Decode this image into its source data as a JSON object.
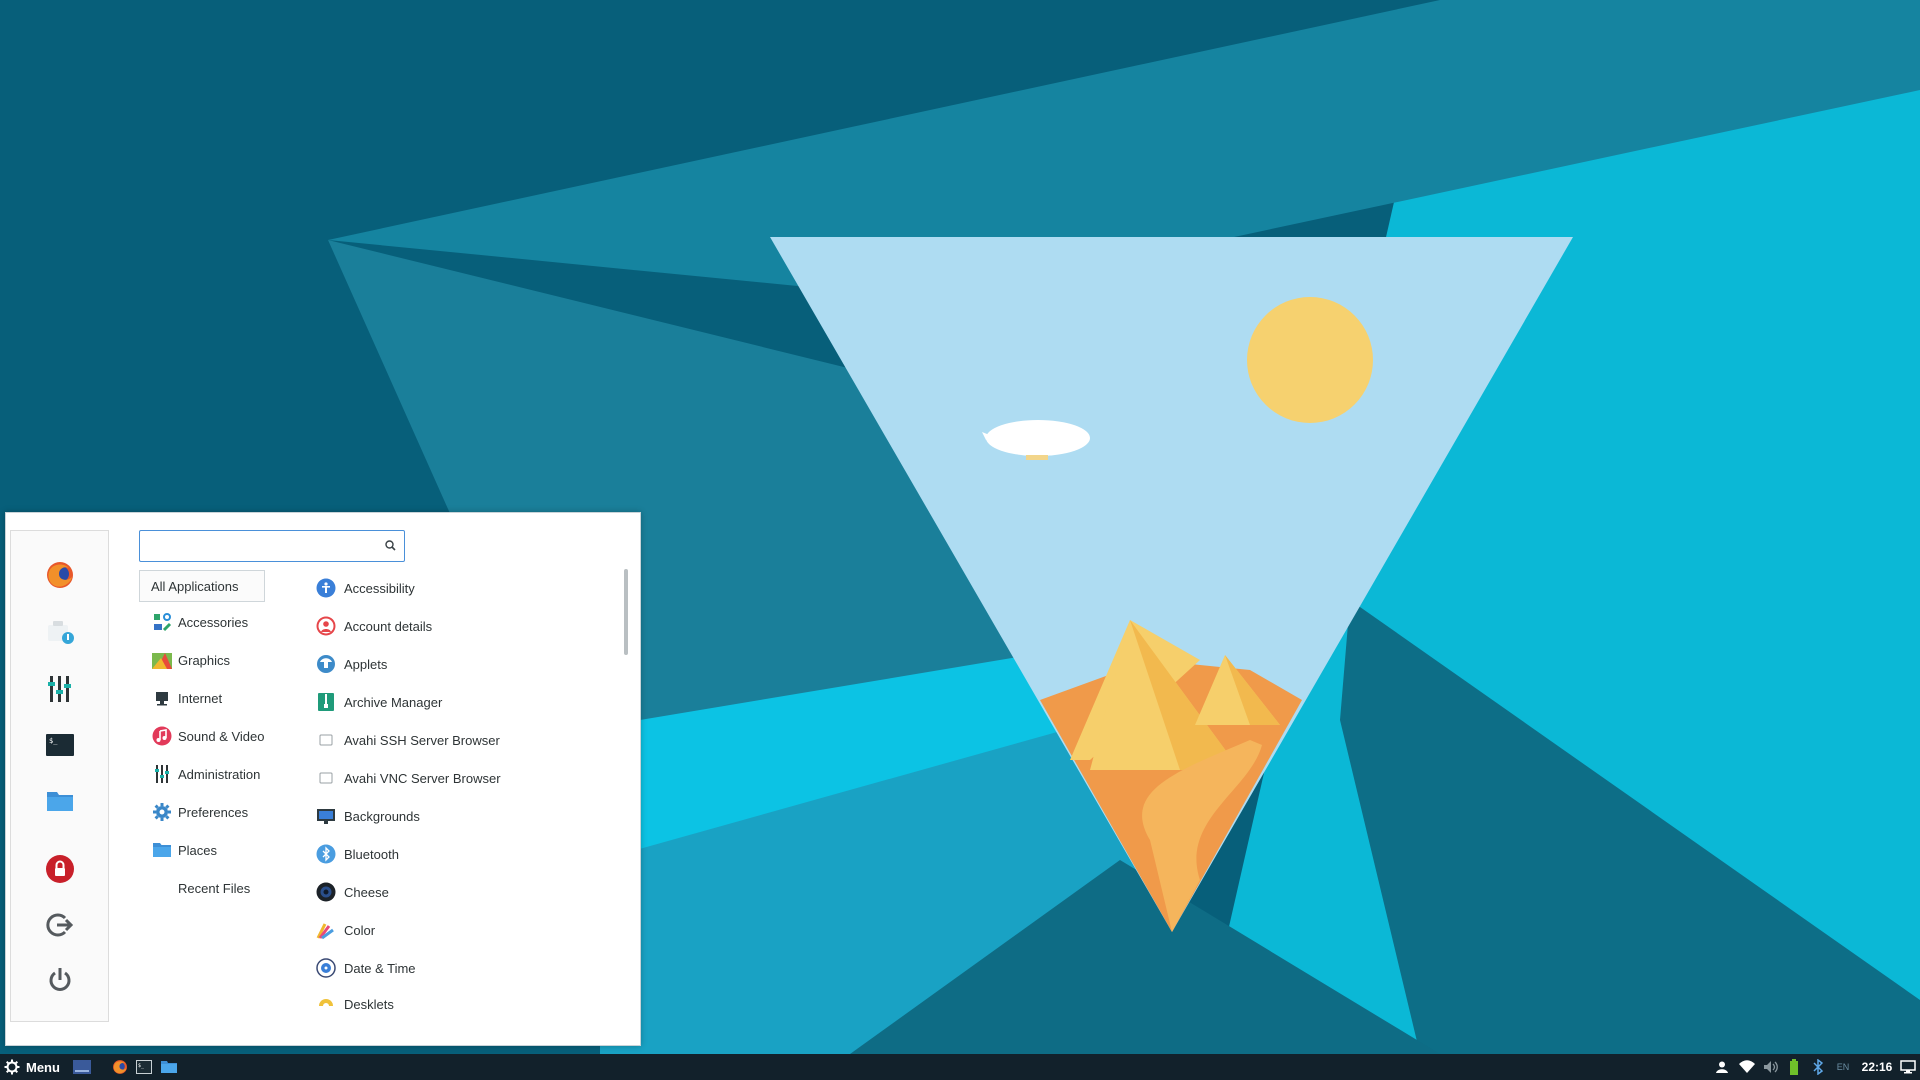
{
  "favorites": [
    {
      "name": "firefox-icon",
      "label": "Firefox"
    },
    {
      "name": "software-manager-icon",
      "label": "Software"
    },
    {
      "name": "settings-icon",
      "label": "Settings"
    },
    {
      "name": "terminal-icon",
      "label": "Terminal"
    },
    {
      "name": "files-icon",
      "label": "Files"
    }
  ],
  "session": [
    {
      "name": "lock-screen-icon"
    },
    {
      "name": "logout-icon"
    },
    {
      "name": "power-icon"
    }
  ],
  "search": {
    "value": "",
    "placeholder": ""
  },
  "categories": [
    {
      "label": "All Applications",
      "icon": "none"
    },
    {
      "label": "Accessories",
      "icon": "accessories-icon"
    },
    {
      "label": "Graphics",
      "icon": "graphics-icon"
    },
    {
      "label": "Internet",
      "icon": "internet-icon"
    },
    {
      "label": "Sound & Video",
      "icon": "sound-video-icon"
    },
    {
      "label": "Administration",
      "icon": "administration-icon"
    },
    {
      "label": "Preferences",
      "icon": "preferences-icon"
    },
    {
      "label": "Places",
      "icon": "places-icon"
    },
    {
      "label": "Recent Files",
      "icon": "none"
    }
  ],
  "apps": [
    {
      "label": "Accessibility",
      "icon": "accessibility-icon"
    },
    {
      "label": "Account details",
      "icon": "account-icon"
    },
    {
      "label": "Applets",
      "icon": "applets-icon"
    },
    {
      "label": "Archive Manager",
      "icon": "archive-icon"
    },
    {
      "label": "Avahi SSH Server Browser",
      "icon": "generic-app-icon"
    },
    {
      "label": "Avahi VNC Server Browser",
      "icon": "generic-app-icon"
    },
    {
      "label": "Backgrounds",
      "icon": "backgrounds-icon"
    },
    {
      "label": "Bluetooth",
      "icon": "bluetooth-icon"
    },
    {
      "label": "Cheese",
      "icon": "cheese-icon"
    },
    {
      "label": "Color",
      "icon": "color-icon"
    },
    {
      "label": "Date & Time",
      "icon": "date-time-icon"
    },
    {
      "label": "Desklets",
      "icon": "desklets-icon"
    }
  ],
  "panel": {
    "menu_label": "Menu",
    "clock": "22:16",
    "keyboard_layout": "EN"
  },
  "colors": {
    "accent": "#4a90d9",
    "panel_bg": "#12212b",
    "desktop_bg": "#0a6e86"
  }
}
